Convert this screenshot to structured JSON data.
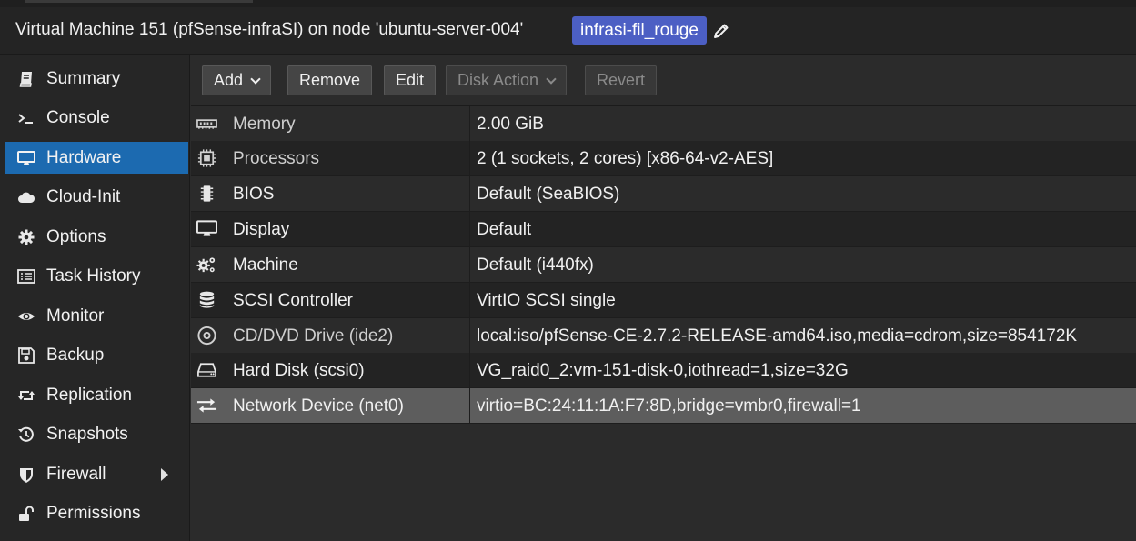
{
  "header": {
    "title": "Virtual Machine 151 (pfSense-infraSI) on node 'ubuntu-server-004'",
    "tag": "infrasi-fil_rouge",
    "tag_color": "#4c5fc4"
  },
  "sidebar": {
    "items": [
      {
        "label": "Summary",
        "icon": "book-icon"
      },
      {
        "label": "Console",
        "icon": "terminal-icon"
      },
      {
        "label": "Hardware",
        "icon": "desktop-icon",
        "active": true
      },
      {
        "label": "Cloud-Init",
        "icon": "cloud-icon"
      },
      {
        "label": "Options",
        "icon": "gear-icon"
      },
      {
        "label": "Task History",
        "icon": "list-icon"
      },
      {
        "label": "Monitor",
        "icon": "eye-icon"
      },
      {
        "label": "Backup",
        "icon": "floppy-icon"
      },
      {
        "label": "Replication",
        "icon": "retweet-icon"
      },
      {
        "label": "Snapshots",
        "icon": "history-icon"
      },
      {
        "label": "Firewall",
        "icon": "shield-icon",
        "has_submenu": true
      },
      {
        "label": "Permissions",
        "icon": "unlock-icon"
      }
    ],
    "active_color": "#1c6ab0"
  },
  "toolbar": {
    "add_label": "Add",
    "remove_label": "Remove",
    "edit_label": "Edit",
    "disk_action_label": "Disk Action",
    "revert_label": "Revert"
  },
  "hardware": {
    "rows": [
      {
        "name": "Memory",
        "value": "2.00 GiB",
        "icon": "memory-icon"
      },
      {
        "name": "Processors",
        "value": "2 (1 sockets, 2 cores) [x86-64-v2-AES]",
        "icon": "cpu-icon"
      },
      {
        "name": "BIOS",
        "value": "Default (SeaBIOS)",
        "icon": "microchip-icon"
      },
      {
        "name": "Display",
        "value": "Default",
        "icon": "desktop-icon"
      },
      {
        "name": "Machine",
        "value": "Default (i440fx)",
        "icon": "cogs-icon"
      },
      {
        "name": "SCSI Controller",
        "value": "VirtIO SCSI single",
        "icon": "database-icon"
      },
      {
        "name": "CD/DVD Drive (ide2)",
        "value": "local:iso/pfSense-CE-2.7.2-RELEASE-amd64.iso,media=cdrom,size=854172K",
        "icon": "cdrom-icon"
      },
      {
        "name": "Hard Disk (scsi0)",
        "value": "VG_raid0_2:vm-151-disk-0,iothread=1,size=32G",
        "icon": "hdd-icon"
      },
      {
        "name": "Network Device (net0)",
        "value": "virtio=BC:24:11:1A:F7:8D,bridge=vmbr0,firewall=1",
        "icon": "exchange-icon",
        "selected": true
      }
    ]
  }
}
